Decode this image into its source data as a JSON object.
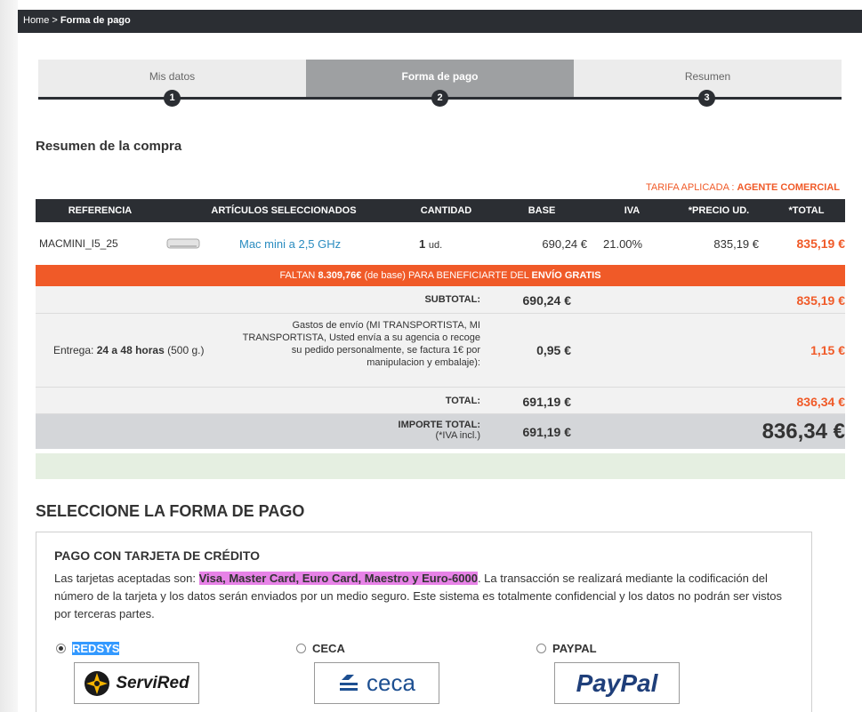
{
  "breadcrumb": {
    "home": "Home",
    "separator": ">",
    "current": "Forma de pago"
  },
  "steps": [
    {
      "label": "Mis datos",
      "number": "1"
    },
    {
      "label": "Forma de pago",
      "number": "2"
    },
    {
      "label": "Resumen",
      "number": "3"
    }
  ],
  "summary": {
    "title": "Resumen de la compra",
    "tarifa_label": "TARIFA APLICADA :",
    "tarifa_value": "AGENTE COMERCIAL"
  },
  "table": {
    "headers": [
      "REFERENCIA",
      "ARTÍCULOS SELECCIONADOS",
      "CANTIDAD",
      "BASE",
      "IVA",
      "*PRECIO UD.",
      "*TOTAL"
    ],
    "row": {
      "ref": "MACMINI_I5_25",
      "name": "Mac mini a 2,5 GHz",
      "qty": "1",
      "qty_unit": "ud.",
      "base": "690,24 €",
      "iva": "21.00%",
      "precio": "835,19 €",
      "total": "835,19 €"
    }
  },
  "banner": {
    "pre": "FALTAN",
    "amount": "8.309,76€",
    "mid": "(de base) PARA BENEFICIARTE DEL",
    "strong": "ENVÍO GRATIS"
  },
  "totals": {
    "subtotal_label": "SUBTOTAL:",
    "subtotal_base": "690,24 €",
    "subtotal_total": "835,19 €",
    "entrega_label": "Entrega:",
    "entrega_value": "24 a 48 horas",
    "entrega_weight": "(500 g.)",
    "shipping_desc": "Gastos de envío (MI TRANSPORTISTA, MI TRANSPORTISTA, Usted envía a su agencia o recoge su pedido personalmente, se factura 1€ por manipulacion y embalaje):",
    "shipping_base": "0,95 €",
    "shipping_total": "1,15 €",
    "total_label": "TOTAL:",
    "total_base": "691,19 €",
    "total_total": "836,34 €",
    "importe_label": "IMPORTE TOTAL:",
    "importe_note": "(*IVA incl.)",
    "importe_base": "691,19 €",
    "importe_total": "836,34 €"
  },
  "payment": {
    "section_title": "SELECCIONE LA FORMA DE PAGO",
    "card_title": "PAGO CON TARJETA DE CRÉDITO",
    "text_pre": "Las tarjetas aceptadas son:",
    "text_cards": "Visa, Master Card, Euro Card, Maestro y Euro-6000",
    "text_post": ". La transacción se realizará mediante la codificación del número de la tarjeta y los datos serán enviados por un medio seguro. Este sistema es totalmente confidencial y los datos no podrán ser vistos por terceras partes.",
    "options": [
      {
        "label": "REDSYS",
        "selected": true,
        "logo": "ServiRed"
      },
      {
        "label": "CECA",
        "selected": false,
        "logo": "ceca"
      },
      {
        "label": "PAYPAL",
        "selected": false,
        "logo": "PayPal"
      }
    ]
  },
  "colors": {
    "accent": "#f05a28",
    "dark": "#2b2e33",
    "highlight": "#e782e7"
  }
}
